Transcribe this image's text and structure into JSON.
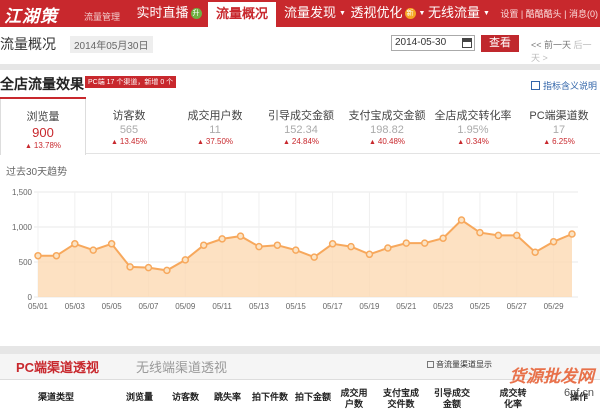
{
  "logo": {
    "script": "江湖策",
    "sub": "流量管理"
  },
  "nav": [
    {
      "label": "实时直播",
      "badge": "升",
      "badge_style": "green"
    },
    {
      "label": "流量概况",
      "active": true
    },
    {
      "label": "流量发现",
      "caret": true
    },
    {
      "label": "透视优化",
      "badge": "新",
      "badge_style": "orange",
      "caret": true
    },
    {
      "label": "无线流量",
      "caret": true
    }
  ],
  "toplinks": "设置 | 酷酷酷头 | 消息(0)",
  "header": {
    "title": "流量概况",
    "date_tag": "2014年05月30日",
    "date_value": "2014-05-30",
    "query": "查看",
    "prev": "<< 前一天",
    "next": "后一天 >"
  },
  "section": {
    "title": "全店流量效果",
    "tag": "PC端 17 个渠道，新增 0 个",
    "help": "指标含义说明"
  },
  "metrics": [
    {
      "label": "浏览量",
      "value": "900",
      "change": "13.78%"
    },
    {
      "label": "访客数",
      "value": "565",
      "change": "13.45%"
    },
    {
      "label": "成交用户数",
      "value": "11",
      "change": "37.50%"
    },
    {
      "label": "引导成交金额",
      "value": "152.34",
      "change": "24.84%"
    },
    {
      "label": "支付宝成交金额",
      "value": "198.82",
      "change": "40.48%"
    },
    {
      "label": "全店成交转化率",
      "value": "1.95%",
      "change": "0.34%"
    },
    {
      "label": "PC端渠道数",
      "value": "17",
      "change": "6.25%"
    }
  ],
  "trend_label": "过去30天趋势",
  "chart_data": {
    "type": "area",
    "x": [
      "05/01",
      "05/02",
      "05/03",
      "05/04",
      "05/05",
      "05/06",
      "05/07",
      "05/08",
      "05/09",
      "05/10",
      "05/11",
      "05/12",
      "05/13",
      "05/14",
      "05/15",
      "05/16",
      "05/17",
      "05/18",
      "05/19",
      "05/20",
      "05/21",
      "05/22",
      "05/23",
      "05/24",
      "05/25",
      "05/26",
      "05/27",
      "05/28",
      "05/29",
      "05/30"
    ],
    "x_ticks": [
      "05/01",
      "05/03",
      "05/05",
      "05/07",
      "05/09",
      "05/11",
      "05/13",
      "05/15",
      "05/17",
      "05/19",
      "05/21",
      "05/23",
      "05/25",
      "05/27",
      "05/29"
    ],
    "y": [
      590,
      590,
      760,
      670,
      760,
      430,
      420,
      380,
      530,
      740,
      830,
      870,
      720,
      740,
      670,
      570,
      760,
      720,
      610,
      700,
      770,
      770,
      840,
      1100,
      920,
      880,
      880,
      640,
      790,
      900
    ],
    "yticks": [
      "0",
      "500",
      "1,000",
      "1,500"
    ],
    "ylim": [
      0,
      1500
    ],
    "grid": true,
    "line_color": "#f7a85c",
    "fill_color": "#fcd9b3",
    "point_fill": "#fbe3c4"
  },
  "channel": {
    "tab_active": "PC端渠道透视",
    "tab_inactive": "无线端渠道透视",
    "checkbox": "音流量渠道显示"
  },
  "table_headers": [
    "渠道类型",
    "浏览量",
    "访客数",
    "跳失率",
    "拍下件数",
    "拍下金额",
    "成交用户数",
    "支付宝成交件数",
    "引导成交金额",
    "成交转化率",
    "操作"
  ],
  "watermark": {
    "big": "货源批发网",
    "small": "6pf.cn"
  }
}
